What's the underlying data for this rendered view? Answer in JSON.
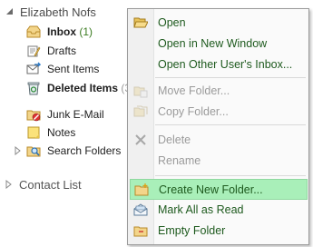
{
  "tree": {
    "account": "Elizabeth Nofs",
    "folders": [
      {
        "label": "Inbox",
        "count": "(1)",
        "bold": true
      },
      {
        "label": "Drafts"
      },
      {
        "label": "Sent Items"
      },
      {
        "label": "Deleted Items",
        "count": "(3)",
        "bold": true
      },
      {
        "label": "Junk E-Mail"
      },
      {
        "label": "Notes"
      },
      {
        "label": "Search Folders"
      }
    ],
    "contact_list": "Contact List"
  },
  "menu": {
    "items": [
      {
        "label": "Open",
        "enabled": true,
        "icon": "open-folder-icon"
      },
      {
        "label": "Open in New Window",
        "enabled": true,
        "icon": ""
      },
      {
        "label": "Open Other User's Inbox...",
        "enabled": true,
        "icon": ""
      },
      {
        "label": "Move Folder...",
        "enabled": false,
        "icon": "move-folder-icon"
      },
      {
        "label": "Copy Folder...",
        "enabled": false,
        "icon": "copy-folder-icon"
      },
      {
        "label": "Delete",
        "enabled": false,
        "icon": "delete-x-icon"
      },
      {
        "label": "Rename",
        "enabled": false,
        "icon": ""
      },
      {
        "label": "Create New Folder...",
        "enabled": true,
        "highlighted": true,
        "icon": "new-folder-icon"
      },
      {
        "label": "Mark All as Read",
        "enabled": true,
        "icon": "mark-read-icon"
      },
      {
        "label": "Empty Folder",
        "enabled": true,
        "icon": "empty-folder-icon"
      }
    ]
  },
  "colors": {
    "highlight": "#a9efb9",
    "menu_text": "#1e5a1e",
    "disabled_text": "#9b9b9b",
    "count_text": "#3a7b20"
  }
}
